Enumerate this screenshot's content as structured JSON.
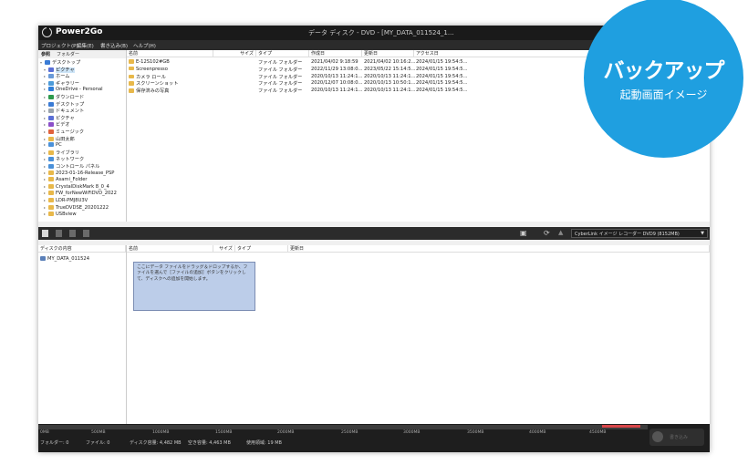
{
  "window": {
    "app_name": "Power2Go",
    "title": "データ ディスク - DVD - [MY_DATA_011524_1..."
  },
  "menu": [
    "プロジェクト(P)",
    "編集(E)",
    "書き込み(B)",
    "ヘルプ(H)"
  ],
  "tree": {
    "tabs": [
      "参照",
      "フォルダー"
    ],
    "items": [
      {
        "label": "デスクトップ",
        "color": "#3a7bd5"
      },
      {
        "label": "ピクチャ",
        "color": "#5a6fd6",
        "selected": true
      },
      {
        "label": "ホーム",
        "color": "#6a9ad8"
      },
      {
        "label": "ギャラリー",
        "color": "#4c9bd9"
      },
      {
        "label": "OneDrive - Personal",
        "color": "#2f7ed8"
      },
      {
        "label": "ダウンロード",
        "color": "#2e9a4c"
      },
      {
        "label": "デスクトップ",
        "color": "#3a7bd5"
      },
      {
        "label": "ドキュメント",
        "color": "#9aa3ad"
      },
      {
        "label": "ピクチャ",
        "color": "#5a6fd6"
      },
      {
        "label": "ビデオ",
        "color": "#8b4fc9"
      },
      {
        "label": "ミュージック",
        "color": "#e0623d"
      },
      {
        "label": "山田太郎",
        "color": "#e8b84a"
      },
      {
        "label": "PC",
        "color": "#4a90d9"
      },
      {
        "label": "ライブラリ",
        "color": "#e8b84a"
      },
      {
        "label": "ネットワーク",
        "color": "#4a90d9"
      },
      {
        "label": "コントロール パネル",
        "color": "#4a90d9"
      },
      {
        "label": "2023-01-16-Release_PSP",
        "color": "#e8b84a"
      },
      {
        "label": "Asami_Folder",
        "color": "#e8b84a"
      },
      {
        "label": "CrystalDiskMark 8_0_4",
        "color": "#e8b84a"
      },
      {
        "label": "FW_forNewWiFiDVD_2022",
        "color": "#e8b84a"
      },
      {
        "label": "LDR-PMJ8U3V",
        "color": "#e8b84a"
      },
      {
        "label": "TrueDVDSE_20201222",
        "color": "#e8b84a"
      },
      {
        "label": "USBview",
        "color": "#e8b84a"
      }
    ]
  },
  "file_list": {
    "columns": [
      "名前",
      "サイズ",
      "タイプ",
      "作成日",
      "更新日",
      "アクセス日"
    ],
    "rows": [
      {
        "name": "E-12S102#GB",
        "size": "",
        "type": "ファイル フォルダー",
        "created": "2021/04/02 9:18:59",
        "modified": "2021/04/02 10:16:2...",
        "accessed": "2024/01/15 19:54:5..."
      },
      {
        "name": "Screenpresso",
        "size": "",
        "type": "ファイル フォルダー",
        "created": "2022/11/29 13:08:0...",
        "modified": "2023/05/22 15:14:5...",
        "accessed": "2024/01/15 19:54:5..."
      },
      {
        "name": "カメラ ロール",
        "size": "",
        "type": "ファイル フォルダー",
        "created": "2020/10/13 11:24:1...",
        "modified": "2020/10/13 11:24:1...",
        "accessed": "2024/01/15 19:54:5..."
      },
      {
        "name": "スクリーンショット",
        "size": "",
        "type": "ファイル フォルダー",
        "created": "2020/12/07 10:08:0...",
        "modified": "2020/10/13 10:50:1...",
        "accessed": "2024/01/15 19:54:5..."
      },
      {
        "name": "保存済みの写真",
        "size": "",
        "type": "ファイル フォルダー",
        "created": "2020/10/13 11:24:1...",
        "modified": "2020/10/13 11:24:1...",
        "accessed": "2024/01/15 19:54:5..."
      }
    ]
  },
  "recorder": {
    "selected": "CyberLink イメージ レコーダー DVD9 (8152MB)"
  },
  "disc": {
    "tree_header": "ディスクの内容",
    "disc_label": "MY_DATA_011524",
    "columns": [
      "名前",
      "サイズ",
      "タイプ",
      "更新日"
    ],
    "hint": "ここにデータ ファイルをドラッグ＆ドロップするか、ファイルを選んで［ファイルの追加］ボタンをクリックして、ディスクへの追加を開始します。"
  },
  "capacity": {
    "ticks": [
      "0MB",
      "500MB",
      "1000MB",
      "1500MB",
      "2000MB",
      "2500MB",
      "3000MB",
      "3500MB",
      "4000MB",
      "4500MB"
    ],
    "used_fraction": 0,
    "stats": [
      "フォルダー: 0",
      "ファイル: 0",
      "ディスク容量: 4,482 MB",
      "空き容量: 4,463 MB",
      "使用領域: 19 MB"
    ]
  },
  "burn_label": "書き込み",
  "promo": {
    "title": "バックアップ",
    "subtitle": "起動画面イメージ"
  }
}
